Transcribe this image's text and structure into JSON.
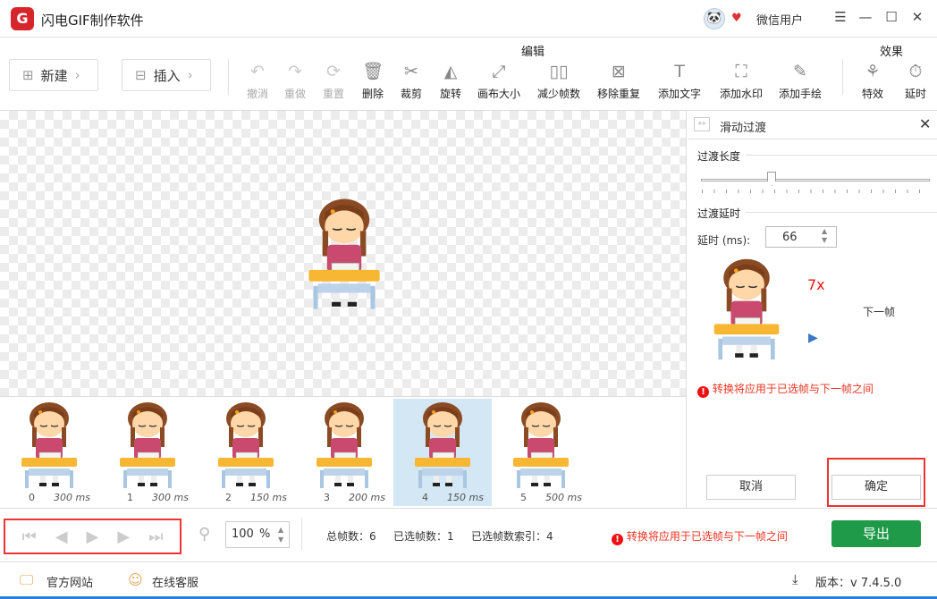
{
  "app": {
    "title": "闪电GIF制作软件",
    "user": "微信用户",
    "logo": "G"
  },
  "toolbar": {
    "new": "新建",
    "insert": "插入",
    "group_edit": "编辑",
    "group_effect": "效果",
    "tools": [
      {
        "id": "undo",
        "label": "撤消",
        "icon": "↶",
        "disabled": true
      },
      {
        "id": "redo",
        "label": "重做",
        "icon": "↷",
        "disabled": true
      },
      {
        "id": "reset",
        "label": "重置",
        "icon": "⟳",
        "disabled": true
      },
      {
        "id": "delete",
        "label": "删除",
        "icon": "🗑",
        "disabled": false
      },
      {
        "id": "crop",
        "label": "裁剪",
        "icon": "✂",
        "disabled": false
      },
      {
        "id": "rotate",
        "label": "旋转",
        "icon": "◭",
        "disabled": false
      },
      {
        "id": "canvas-size",
        "label": "画布大小",
        "icon": "⤢",
        "disabled": false
      },
      {
        "id": "reduce-frames",
        "label": "减少帧数",
        "icon": "▯▯",
        "disabled": false
      },
      {
        "id": "remove-dup",
        "label": "移除重复",
        "icon": "⊠",
        "disabled": false
      },
      {
        "id": "add-text",
        "label": "添加文字",
        "icon": "T",
        "disabled": false
      },
      {
        "id": "add-watermark",
        "label": "添加水印",
        "icon": "⛶",
        "disabled": false
      },
      {
        "id": "add-draw",
        "label": "添加手绘",
        "icon": "✎",
        "disabled": false
      },
      {
        "id": "effects",
        "label": "特效",
        "icon": "⚘",
        "disabled": false
      },
      {
        "id": "delay",
        "label": "延时",
        "icon": "⏱",
        "disabled": false
      }
    ]
  },
  "frames": [
    {
      "index": "0",
      "duration": "300 ms"
    },
    {
      "index": "1",
      "duration": "300 ms"
    },
    {
      "index": "2",
      "duration": "150 ms"
    },
    {
      "index": "3",
      "duration": "200 ms"
    },
    {
      "index": "4",
      "duration": "150 ms",
      "selected": true
    },
    {
      "index": "5",
      "duration": "500 ms"
    }
  ],
  "panel": {
    "title": "滑动过渡",
    "length_label": "过渡长度",
    "length_value": 0.25,
    "delay_section": "过渡延时",
    "delay_label": "延时 (ms):",
    "delay_value": "66",
    "speed": "7x",
    "next_label": "下一帧",
    "warning": "转换将应用于已选帧与下一帧之间",
    "cancel": "取消",
    "ok": "确定"
  },
  "status": {
    "zoom": "100",
    "zoom_unit": "%",
    "total": "总帧数：6",
    "selected": "已选帧数：1",
    "index": "已选帧数索引：4",
    "warning": "转换将应用于已选帧与下一帧之间",
    "export": "导出"
  },
  "footer": {
    "website": "官方网站",
    "support": "在线客服",
    "version": "版本：v 7.4.5.0"
  }
}
